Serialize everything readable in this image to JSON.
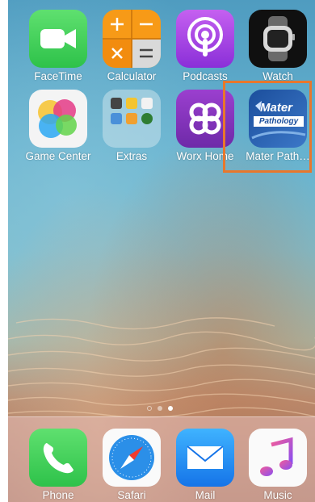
{
  "home": {
    "apps": [
      {
        "label": "FaceTime",
        "icon": "facetime-icon"
      },
      {
        "label": "Calculator",
        "icon": "calculator-icon"
      },
      {
        "label": "Podcasts",
        "icon": "podcasts-icon"
      },
      {
        "label": "Watch",
        "icon": "watch-icon"
      },
      {
        "label": "Game Center",
        "icon": "game-center-icon"
      },
      {
        "label": "Extras",
        "icon": "extras-folder-icon"
      },
      {
        "label": "Worx Home",
        "icon": "worx-home-icon"
      },
      {
        "label": "Mater Path…",
        "icon": "mater-pathology-icon",
        "icon_text_1": "Mater",
        "icon_text_2": "Pathology"
      }
    ],
    "page_indicator": {
      "pages": 2,
      "current": 2
    }
  },
  "dock": {
    "apps": [
      {
        "label": "Phone",
        "icon": "phone-icon"
      },
      {
        "label": "Safari",
        "icon": "safari-icon"
      },
      {
        "label": "Mail",
        "icon": "mail-icon"
      },
      {
        "label": "Music",
        "icon": "music-icon"
      }
    ]
  },
  "highlight_color": "#e8772c"
}
